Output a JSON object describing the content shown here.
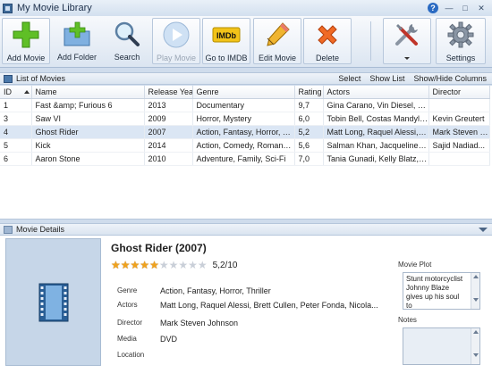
{
  "window": {
    "title": "My Movie Library"
  },
  "toolbar": {
    "buttons": [
      {
        "label": "Add Movie"
      },
      {
        "label": "Add Folder"
      },
      {
        "label": "Search"
      },
      {
        "label": "Play Movie"
      },
      {
        "label": "Go to IMDB",
        "icon_text": "IMDb"
      },
      {
        "label": "Edit Movie"
      },
      {
        "label": "Delete"
      },
      {
        "label": ""
      },
      {
        "label": "Settings"
      }
    ]
  },
  "list_panel": {
    "title": "List of Movies",
    "links": {
      "select": "Select",
      "show_list": "Show List",
      "show_hide_columns": "Show/Hide Columns"
    },
    "columns": [
      "ID",
      "Name",
      "Release Year",
      "Genre",
      "Rating",
      "Actors",
      "Director"
    ],
    "rows": [
      {
        "id": "1",
        "name": "Fast &amp; Furious 6",
        "year": "2013",
        "genre": "Documentary",
        "rating": "9,7",
        "actors": "Gina Carano, Vin Diesel, Gal ...",
        "director": ""
      },
      {
        "id": "3",
        "name": "Saw VI",
        "year": "2009",
        "genre": "Horror, Mystery",
        "rating": "6,0",
        "actors": "Tobin Bell, Costas Mandylor...",
        "director": "Kevin Greutert"
      },
      {
        "id": "4",
        "name": "Ghost Rider",
        "year": "2007",
        "genre": "Action, Fantasy, Horror, Th...",
        "rating": "5,2",
        "actors": "Matt Long, Raquel Alessi, Br...",
        "director": "Mark Steven J..."
      },
      {
        "id": "5",
        "name": "Kick",
        "year": "2014",
        "genre": "Action, Comedy, Romance...",
        "rating": "5,6",
        "actors": "Salman Khan, Jacqueline Fer...",
        "director": "Sajid Nadiad..."
      },
      {
        "id": "6",
        "name": "Aaron Stone",
        "year": "2010",
        "genre": "Adventure, Family, Sci-Fi",
        "rating": "7,0",
        "actors": "Tania Gunadi, Kelly Blatz, Da...",
        "director": ""
      }
    ],
    "selected_row": 2
  },
  "details_panel": {
    "title": "Movie Details",
    "movie_title": "Ghost Rider (2007)",
    "rating_text": "5,2/10",
    "stars_filled": 5,
    "stars_total": 10,
    "fields": {
      "genre_label": "Genre",
      "genre": "Action, Fantasy, Horror, Thriller",
      "actors_label": "Actors",
      "actors": "Matt Long, Raquel Alessi, Brett Cullen, Peter Fonda, Nicola...",
      "director_label": "Director",
      "director": "Mark Steven Johnson",
      "media_label": "Media",
      "media": "DVD",
      "location_label": "Location",
      "location": ""
    },
    "plot_label": "Movie Plot",
    "plot_text": "Stunt motorcyclist Johnny Blaze gives up his soul to",
    "notes_label": "Notes",
    "notes_text": ""
  },
  "colors": {
    "star_on": "#f0a21c",
    "star_off": "#c9cfd8",
    "selection": "#dbe6f4",
    "accent": "#2a6ac2"
  }
}
